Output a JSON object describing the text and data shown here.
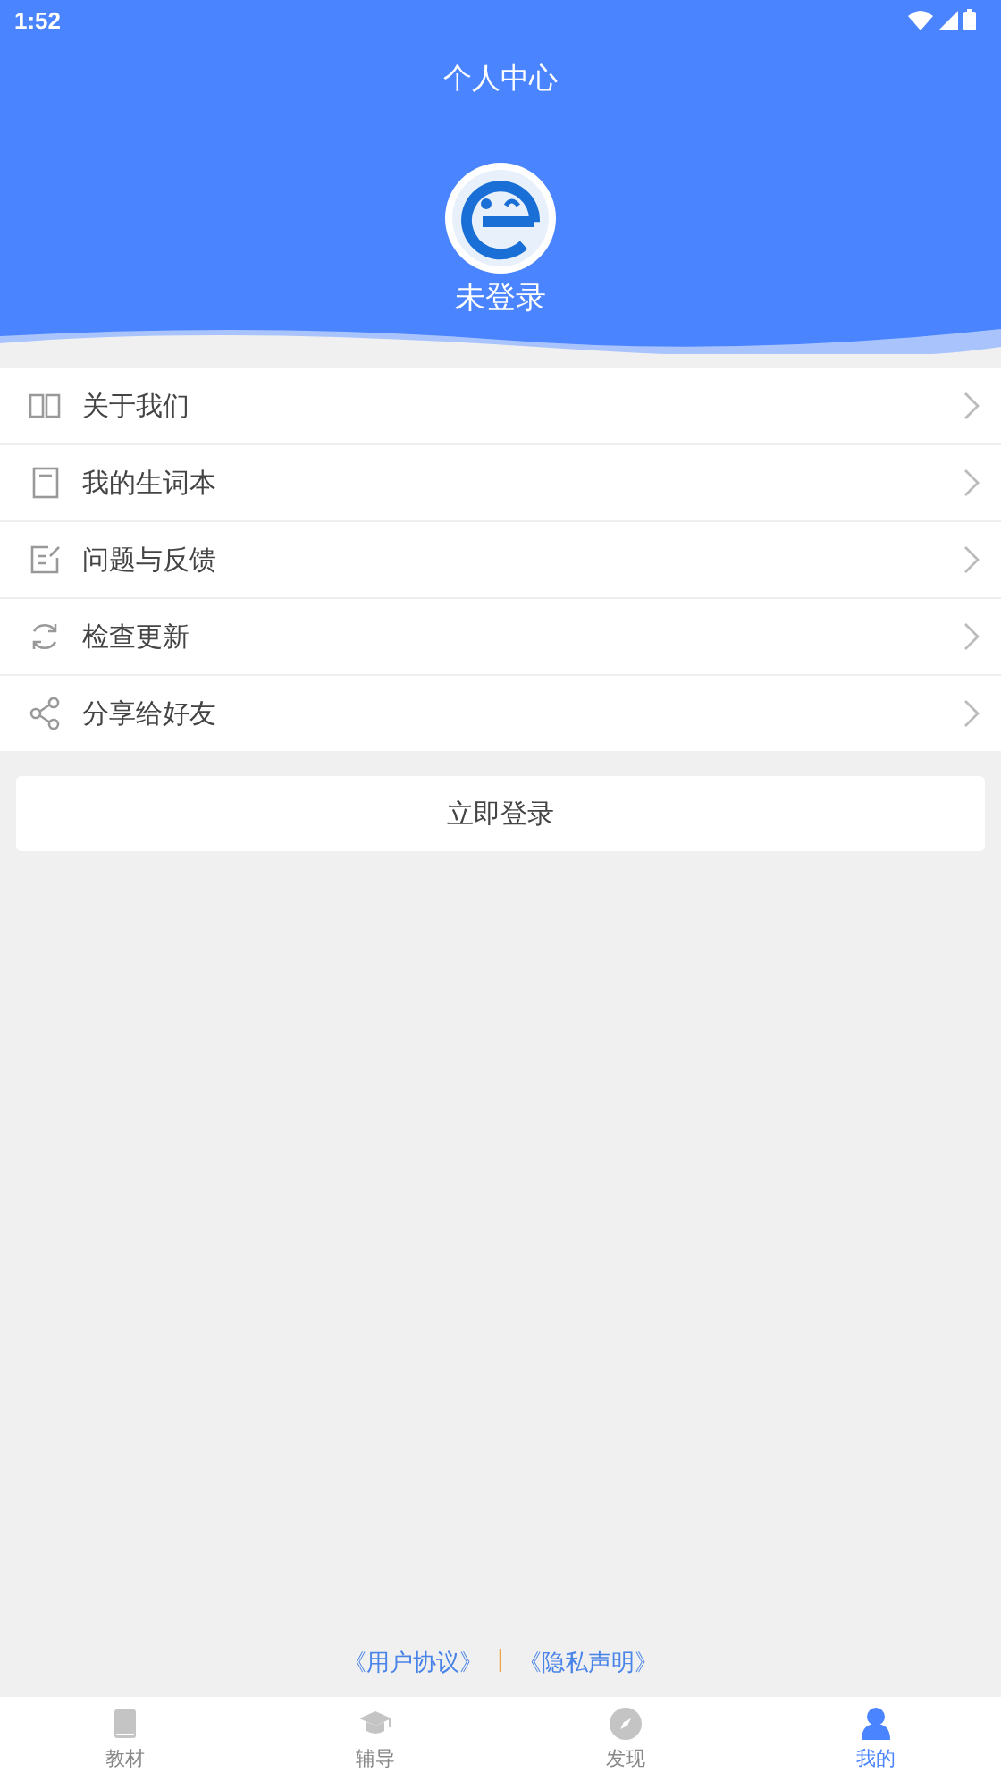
{
  "status_bar": {
    "time": "1:52"
  },
  "header": {
    "title": "个人中心",
    "user_status": "未登录"
  },
  "menu": [
    {
      "label": "关于我们"
    },
    {
      "label": "我的生词本"
    },
    {
      "label": "问题与反馈"
    },
    {
      "label": "检查更新"
    },
    {
      "label": "分享给好友"
    }
  ],
  "login_button": "立即登录",
  "footer_links": [
    "《用户协议》",
    "|",
    "《隐私声明》"
  ],
  "tabs": [
    {
      "label": "教材",
      "selected": false
    },
    {
      "label": "辅导",
      "selected": false
    },
    {
      "label": "发现",
      "selected": false
    },
    {
      "label": "我的",
      "selected": true
    }
  ]
}
